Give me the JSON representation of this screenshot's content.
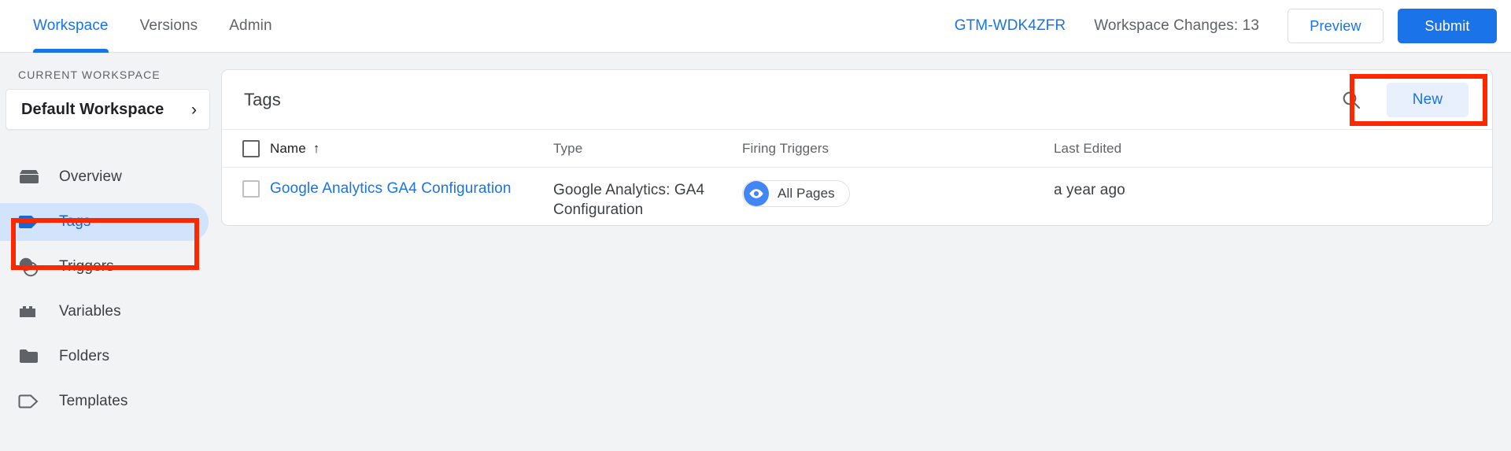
{
  "topnav": {
    "tabs": [
      {
        "label": "Workspace",
        "active": true
      },
      {
        "label": "Versions",
        "active": false
      },
      {
        "label": "Admin",
        "active": false
      }
    ],
    "container_id": "GTM-WDK4ZFR",
    "workspace_changes": "Workspace Changes: 13",
    "preview_label": "Preview",
    "submit_label": "Submit"
  },
  "sidebar": {
    "section_label": "CURRENT WORKSPACE",
    "workspace_name": "Default Workspace",
    "chevron": "›",
    "items": [
      {
        "label": "Overview",
        "icon": "overview-icon",
        "selected": false
      },
      {
        "label": "Tags",
        "icon": "tag-filled-icon",
        "selected": true
      },
      {
        "label": "Triggers",
        "icon": "triggers-icon",
        "selected": false
      },
      {
        "label": "Variables",
        "icon": "variables-icon",
        "selected": false
      },
      {
        "label": "Folders",
        "icon": "folder-icon",
        "selected": false
      },
      {
        "label": "Templates",
        "icon": "template-tag-icon",
        "selected": false
      }
    ]
  },
  "panel": {
    "title": "Tags",
    "search_icon": "search-icon",
    "new_button": "New",
    "columns": {
      "name": "Name",
      "sort_indicator": "↑",
      "type": "Type",
      "firing_triggers": "Firing Triggers",
      "last_edited": "Last Edited"
    },
    "rows": [
      {
        "name": "Google Analytics GA4 Configuration",
        "type": "Google Analytics: GA4 Configuration",
        "trigger": "All Pages",
        "trigger_icon": "eye-icon",
        "last_edited": "a year ago"
      }
    ]
  },
  "highlights": {
    "accent_color": "#fe2800",
    "targets": [
      "sidebar-item-tags",
      "new-button"
    ]
  },
  "colors": {
    "brand_blue": "#1a73e8",
    "selected_nav_bg": "#d2e3fc",
    "page_bg": "#f1f3f4",
    "chip_blue": "#4285f4"
  }
}
